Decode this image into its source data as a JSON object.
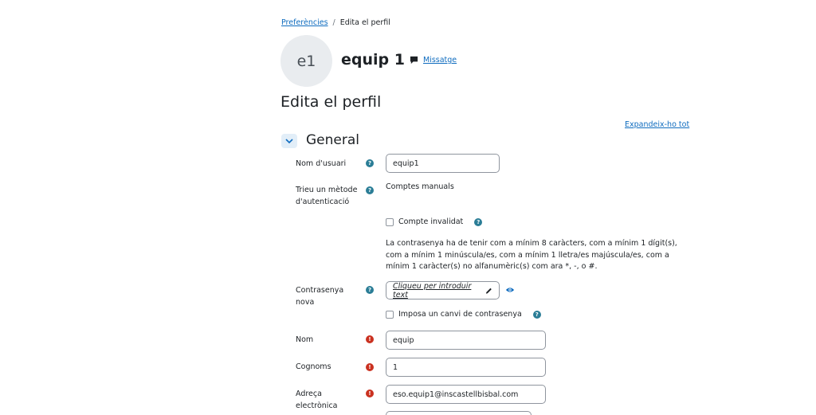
{
  "breadcrumb": {
    "parent": "Preferències",
    "separator": "/",
    "current": "Edita el perfil"
  },
  "user": {
    "initials": "e1",
    "name": "equip 1",
    "message_link": "Missatge"
  },
  "page": {
    "title": "Edita el perfil",
    "expand_all": "Expandeix-ho tot"
  },
  "section": {
    "title": "General"
  },
  "fields": {
    "username": {
      "label": "Nom d'usuari",
      "value": "equip1"
    },
    "auth": {
      "label": "Trieu un mètode d'autenticació",
      "value": "Comptes manuals"
    },
    "suspended": {
      "label": "Compte invalidat"
    },
    "password_rules": "La contrasenya ha de tenir com a mínim 8 caràcters, com a mínim 1 dígit(s), com a mínim 1 minúscula/es, com a mínim 1 lletra/es majúscula/es, com a mínim 1 caràcter(s) no alfanumèric(s) com ara *, -, o #.",
    "new_password": {
      "label": "Contrasenya nova",
      "placeholder": "Cliqueu per introduir text"
    },
    "force_change": {
      "label": "Imposa un canvi de contrasenya"
    },
    "firstname": {
      "label": "Nom",
      "value": "equip"
    },
    "lastname": {
      "label": "Cognoms",
      "value": "1"
    },
    "email": {
      "label": "Adreça electrònica",
      "value": "eso.equip1@inscastellbisbal.com"
    }
  },
  "colors": {
    "link": "#0f6cbf",
    "help_icon": "#2a7d96",
    "required_icon": "#ca3120"
  },
  "icons": {
    "help": "question-circle-icon",
    "required": "exclamation-circle-icon",
    "message": "comment-icon",
    "edit": "pencil-icon",
    "reveal": "eye-icon",
    "collapse": "chevron-down-icon"
  }
}
